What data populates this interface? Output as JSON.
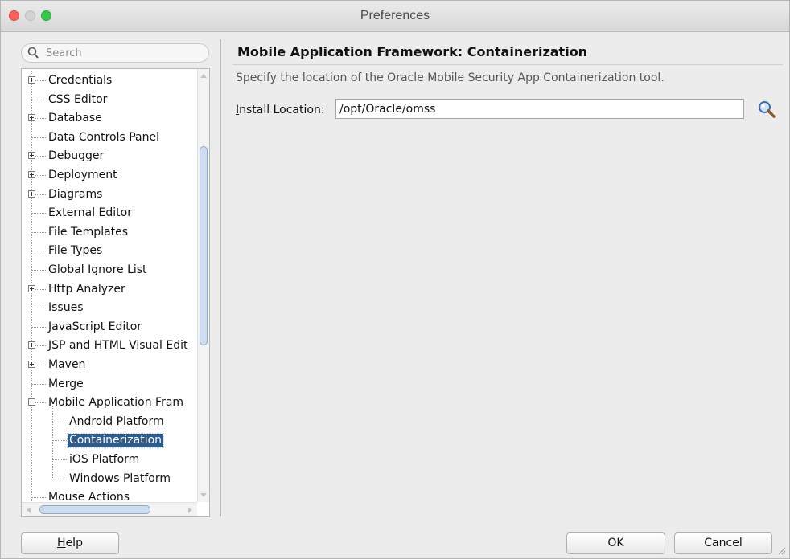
{
  "window": {
    "title": "Preferences"
  },
  "search": {
    "placeholder": "Search"
  },
  "tree": {
    "items": [
      {
        "label": "Credentials",
        "level": 0,
        "expander": "plus"
      },
      {
        "label": "CSS Editor",
        "level": 0,
        "expander": "none"
      },
      {
        "label": "Database",
        "level": 0,
        "expander": "plus"
      },
      {
        "label": "Data Controls Panel",
        "level": 0,
        "expander": "none"
      },
      {
        "label": "Debugger",
        "level": 0,
        "expander": "plus"
      },
      {
        "label": "Deployment",
        "level": 0,
        "expander": "plus"
      },
      {
        "label": "Diagrams",
        "level": 0,
        "expander": "plus"
      },
      {
        "label": "External Editor",
        "level": 0,
        "expander": "none"
      },
      {
        "label": "File Templates",
        "level": 0,
        "expander": "none"
      },
      {
        "label": "File Types",
        "level": 0,
        "expander": "none"
      },
      {
        "label": "Global Ignore List",
        "level": 0,
        "expander": "none"
      },
      {
        "label": "Http Analyzer",
        "level": 0,
        "expander": "plus"
      },
      {
        "label": "Issues",
        "level": 0,
        "expander": "none"
      },
      {
        "label": "JavaScript Editor",
        "level": 0,
        "expander": "none"
      },
      {
        "label": "JSP and HTML Visual Edit",
        "level": 0,
        "expander": "plus"
      },
      {
        "label": "Maven",
        "level": 0,
        "expander": "plus"
      },
      {
        "label": "Merge",
        "level": 0,
        "expander": "none"
      },
      {
        "label": "Mobile Application Fram",
        "level": 0,
        "expander": "minus"
      },
      {
        "label": "Android Platform",
        "level": 1,
        "expander": "none"
      },
      {
        "label": "Containerization",
        "level": 1,
        "expander": "none",
        "selected": true
      },
      {
        "label": "iOS Platform",
        "level": 1,
        "expander": "none"
      },
      {
        "label": "Windows Platform",
        "level": 1,
        "expander": "none"
      },
      {
        "label": "Mouse Actions",
        "level": 0,
        "expander": "none"
      }
    ]
  },
  "panel": {
    "title": "Mobile Application Framework: Containerization",
    "description": "Specify the location of the Oracle Mobile Security App Containerization tool.",
    "install_label_mnemonic": "I",
    "install_label_rest": "nstall Location:",
    "install_value": "/opt/Oracle/omss",
    "browse_icon": "magnifier-search-icon"
  },
  "buttons": {
    "help_mnemonic": "H",
    "help_rest": "elp",
    "ok": "OK",
    "cancel": "Cancel"
  },
  "colors": {
    "selection": "#2d5b8e",
    "scroll_thumb": "#cdddef"
  }
}
